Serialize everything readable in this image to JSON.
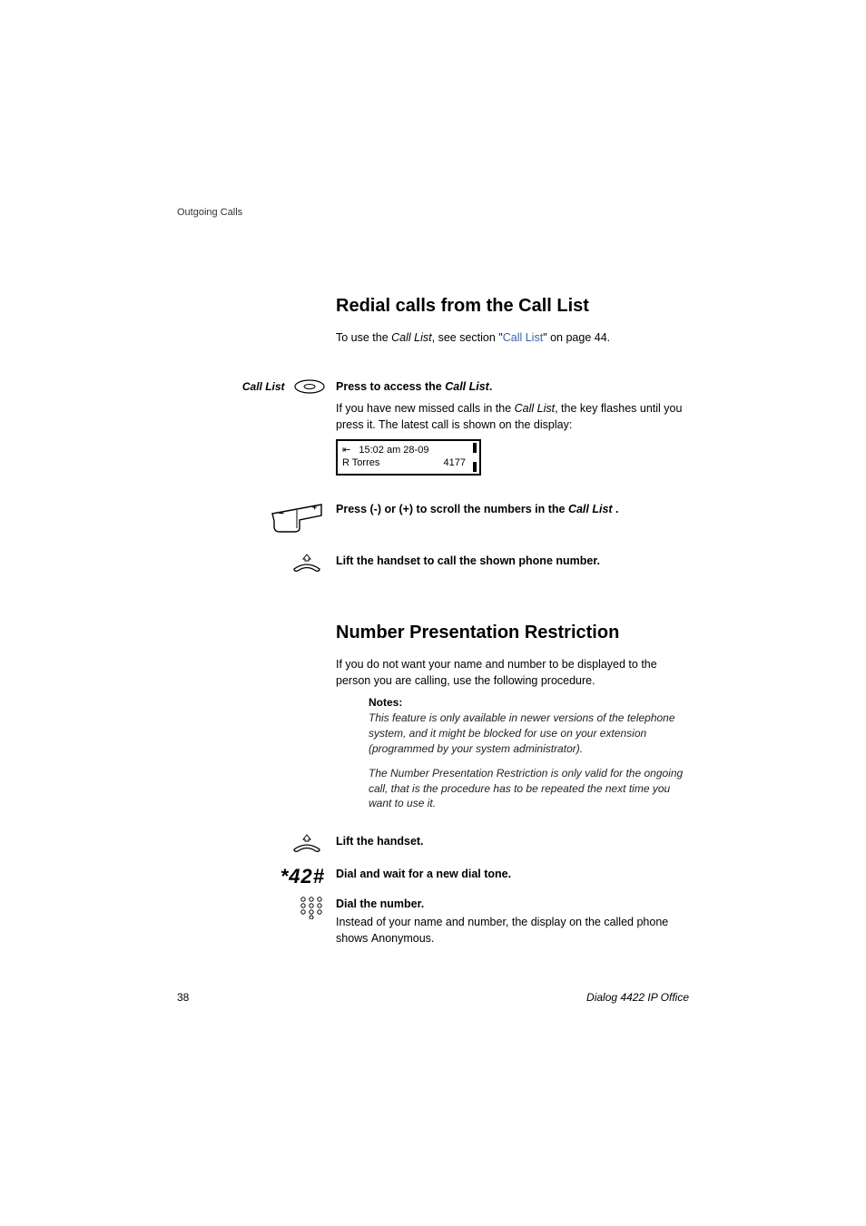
{
  "header": {
    "crumb": "Outgoing Calls"
  },
  "section1": {
    "title": "Redial calls from the Call List",
    "intro_prefix": "To use the ",
    "intro_em": "Call List",
    "intro_mid": ", see section \"",
    "intro_link": "Call List",
    "intro_suffix": "\" on page 44.",
    "left_label": "Call List",
    "press_prefix": "Press to access the ",
    "press_em": "Call List",
    "press_suffix": ".",
    "press_body_prefix": "If you have new missed calls in the ",
    "press_body_em": "Call List",
    "press_body_suffix": ", the key flashes until you press it. The latest call is shown on the display:",
    "display_line1": "15:02 am 28-09",
    "display_line2_name": "R Torres",
    "display_line2_num": "4177",
    "scroll_prefix": "Press (-) or (+) to scroll the numbers in the ",
    "scroll_em": "Call List ",
    "scroll_suffix": ".",
    "lift": "Lift the handset to call the shown phone number."
  },
  "section2": {
    "title": "Number Presentation Restriction",
    "intro": "If you do not want your name and number to be displayed to the person you are calling, use the following procedure.",
    "notes_heading": "Notes:",
    "note1": "This feature is only available in newer versions of the telephone system, and it might be blocked for use on your extension (programmed by your system administrator).",
    "note2": "The Number Presentation Restriction is only valid for the ongoing call, that is the procedure has to be repeated the next time you want to use it.",
    "lift": "Lift the handset.",
    "code": "*42#",
    "dial_tone": "Dial and wait for a new dial tone.",
    "dial_num_heading": "Dial the number.",
    "dial_num_body_prefix": "Instead of  your name and number, the display on the called phone shows ",
    "dial_num_body_sans": "Anonymous",
    "dial_num_body_suffix": "."
  },
  "footer": {
    "page": "38",
    "product": "Dialog 4422 IP Office"
  }
}
